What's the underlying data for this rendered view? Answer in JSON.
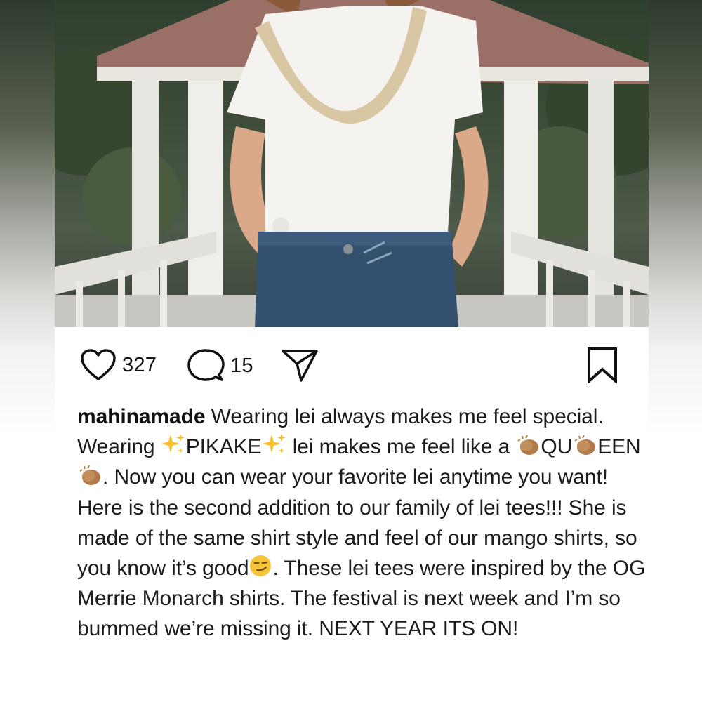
{
  "post": {
    "image_alt": "Woman in white lei t-shirt and jeans standing in front of a white gazebo",
    "likes": "327",
    "comments": "15"
  },
  "icons": {
    "like": "heart-icon",
    "comment": "comment-bubble-icon",
    "share": "paper-plane-icon",
    "save": "bookmark-icon",
    "sparkles": "sparkles-emoji",
    "clap": "clapping-hands-emoji",
    "smirk": "smirking-face-emoji"
  },
  "caption": {
    "username": "mahinamade",
    "p1_t1": " Wearing lei always makes me feel special. Wearing ",
    "p1_pikake": "PIKAKE",
    "p1_t2": " lei makes me feel like a ",
    "p1_qu": "QU",
    "p1_een": "EEN",
    "p1_t3": ". Now you can wear your favorite lei anytime you want!",
    "p2_t1": "Here is the second addition to our family of lei tees!!! She is made of the same shirt style and feel of our mango shirts, so you know it’s good",
    "p2_t2": ". These lei tees were inspired by the OG Merrie Monarch shirts. The festival is next week and I’m so bummed we’re missing it. NEXT YEAR ITS ON!"
  },
  "colors": {
    "text": "#1c1c1c",
    "icon": "#111111",
    "shirt": "#f4f3ef",
    "lei": "#d9c6a2",
    "jeans": "#34506f"
  }
}
